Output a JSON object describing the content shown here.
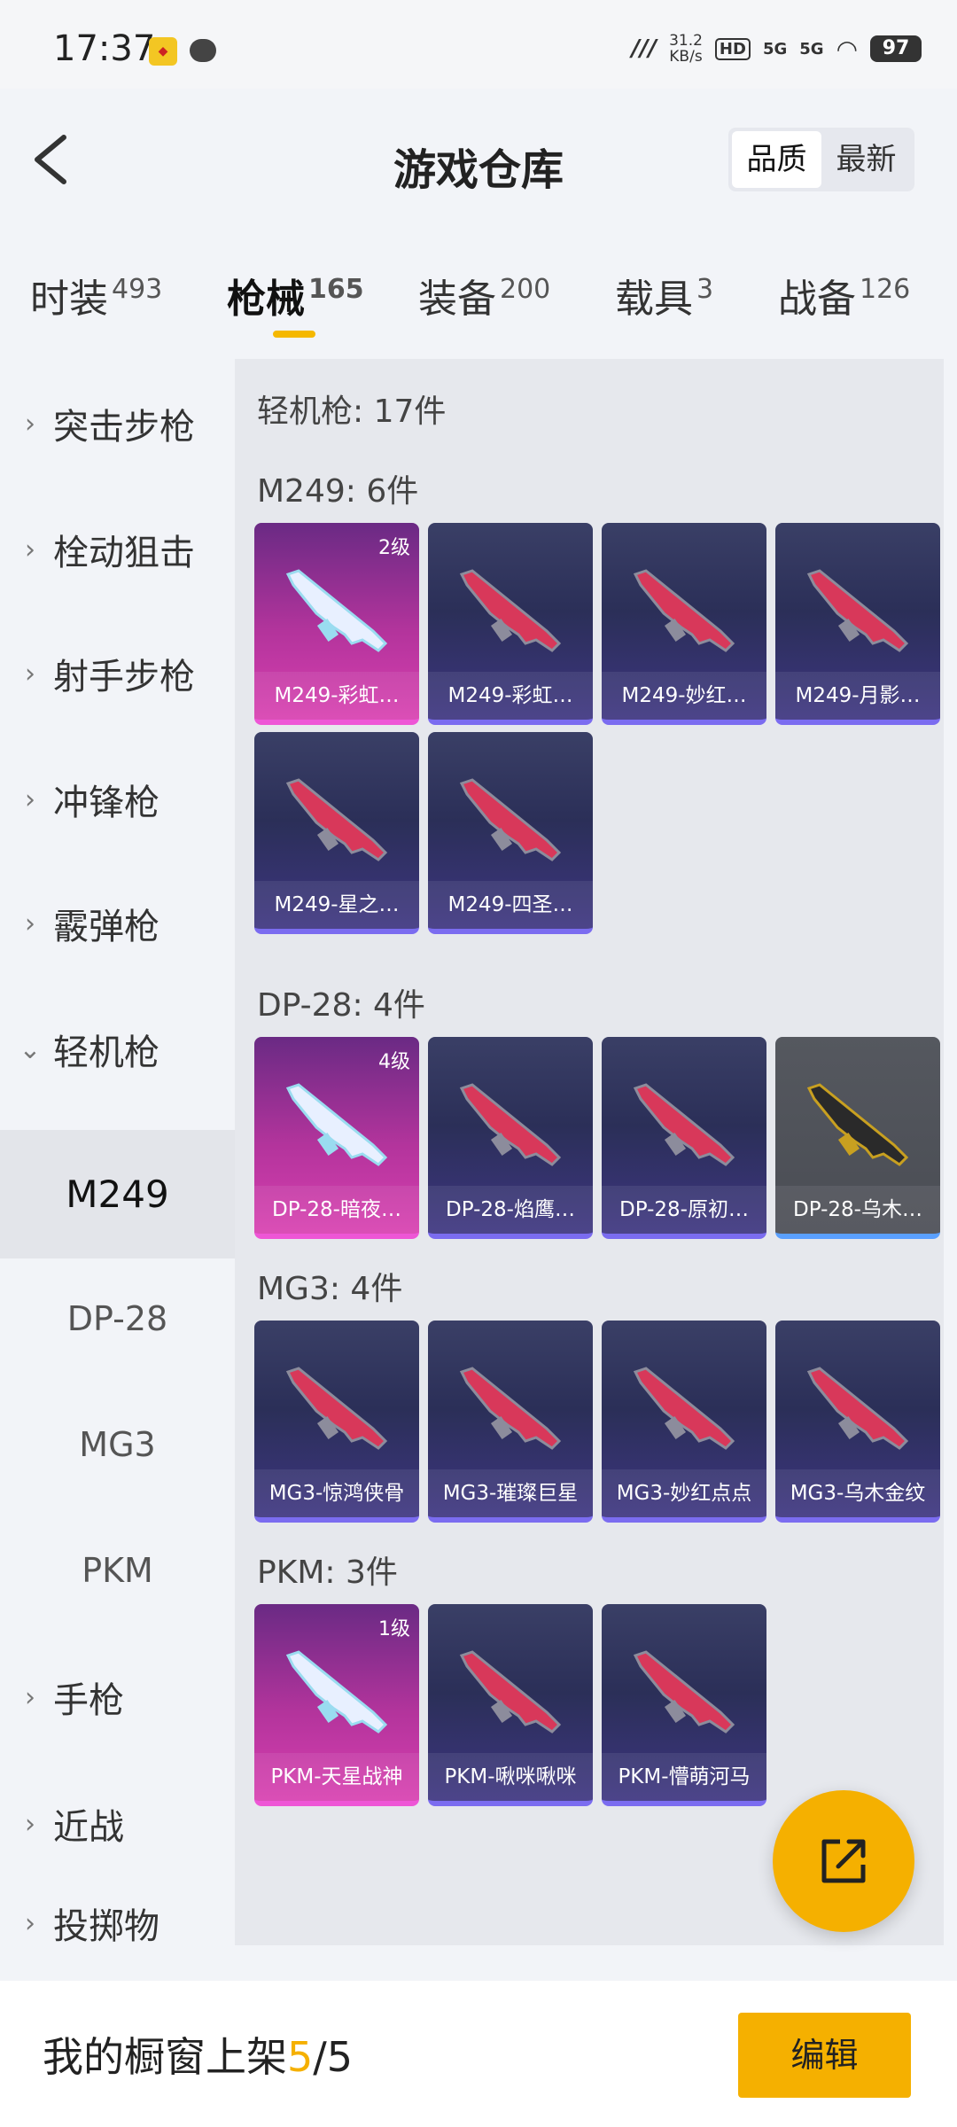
{
  "status_bar": {
    "time": "17:37",
    "net_speed_value": "31.2",
    "net_speed_unit": "KB/s",
    "hd": "HD",
    "sig1": "5G",
    "sig2": "5G",
    "battery": "97"
  },
  "header": {
    "title": "游戏仓库",
    "sort_options": [
      "品质",
      "最新"
    ],
    "active_sort": "品质"
  },
  "category_tabs": [
    {
      "label": "时装",
      "count": "493"
    },
    {
      "label": "枪械",
      "count": "165"
    },
    {
      "label": "装备",
      "count": "200"
    },
    {
      "label": "载具",
      "count": "3"
    },
    {
      "label": "战备",
      "count": "126"
    }
  ],
  "active_category": "枪械",
  "sidebar": {
    "items": [
      {
        "label": "突击步枪"
      },
      {
        "label": "栓动狙击"
      },
      {
        "label": "射手步枪"
      },
      {
        "label": "冲锋枪"
      },
      {
        "label": "霰弹枪"
      },
      {
        "label": "轻机枪"
      }
    ],
    "subitems": [
      {
        "label": "M249"
      },
      {
        "label": "DP-28"
      },
      {
        "label": "MG3"
      },
      {
        "label": "PKM"
      }
    ],
    "items_after": [
      {
        "label": "手枪"
      },
      {
        "label": "近战"
      },
      {
        "label": "投掷物"
      }
    ],
    "selected_sub": "M249"
  },
  "content": {
    "summary": "轻机枪: 17件",
    "groups": [
      {
        "title": "M249: 6件",
        "items": [
          {
            "name": "M249-彩虹…",
            "level": "2级",
            "rarity": "epic"
          },
          {
            "name": "M249-彩虹…",
            "level": "",
            "rarity": "normal"
          },
          {
            "name": "M249-妙红…",
            "level": "",
            "rarity": "normal"
          },
          {
            "name": "M249-月影…",
            "level": "",
            "rarity": "normal"
          },
          {
            "name": "M249-星之…",
            "level": "",
            "rarity": "normal"
          },
          {
            "name": "M249-四圣…",
            "level": "",
            "rarity": "normal"
          }
        ]
      },
      {
        "title": "DP-28: 4件",
        "items": [
          {
            "name": "DP-28-暗夜…",
            "level": "4级",
            "rarity": "epic"
          },
          {
            "name": "DP-28-焰鹰…",
            "level": "",
            "rarity": "normal"
          },
          {
            "name": "DP-28-原初…",
            "level": "",
            "rarity": "normal"
          },
          {
            "name": "DP-28-乌木…",
            "level": "",
            "rarity": "gray"
          }
        ]
      },
      {
        "title": "MG3: 4件",
        "items": [
          {
            "name": "MG3-惊鸿侠骨",
            "level": "",
            "rarity": "normal"
          },
          {
            "name": "MG3-璀璨巨星",
            "level": "",
            "rarity": "normal"
          },
          {
            "name": "MG3-妙红点点",
            "level": "",
            "rarity": "normal"
          },
          {
            "name": "MG3-乌木金纹",
            "level": "",
            "rarity": "normal"
          }
        ]
      },
      {
        "title": "PKM: 3件",
        "items": [
          {
            "name": "PKM-天星战神",
            "level": "1级",
            "rarity": "epic"
          },
          {
            "name": "PKM-啾咪啾咪",
            "level": "",
            "rarity": "normal"
          },
          {
            "name": "PKM-懵萌河马",
            "level": "",
            "rarity": "normal"
          }
        ]
      }
    ]
  },
  "bottom_bar": {
    "label": "我的橱窗上架",
    "current": "5",
    "separator": "/",
    "total": "5",
    "edit_label": "编辑"
  },
  "colors": {
    "accent": "#f5b000",
    "epic_card": "#d83fb0",
    "normal_card": "#2b2f58"
  },
  "icons": [
    "back-arrow-icon",
    "share-icon",
    "chevron-right-icon",
    "chevron-down-icon",
    "gun-icon"
  ]
}
